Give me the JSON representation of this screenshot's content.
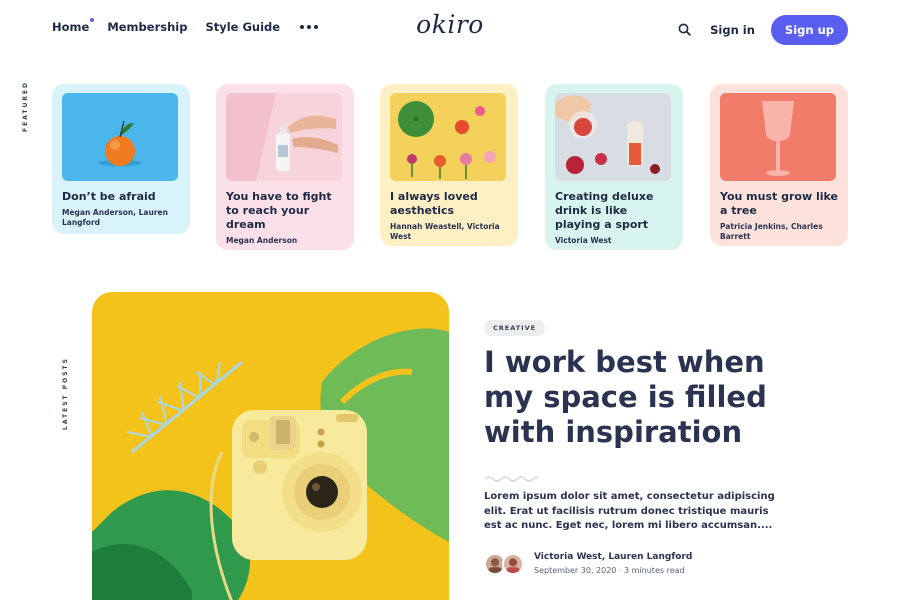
{
  "header": {
    "nav": [
      "Home",
      "Membership",
      "Style Guide"
    ],
    "logo": "okiro",
    "signin": "Sign in",
    "signup": "Sign up",
    "accent": "#5a5ef0"
  },
  "sections": {
    "featured": "FEATURED",
    "latest": "LATEST POSTS"
  },
  "featured": [
    {
      "title": "Don’t be afraid",
      "authors": "Megan Anderson, Lauren Langford",
      "bg": "#d9f3fb"
    },
    {
      "title": "You have to fight to reach your dream",
      "authors": "Megan Anderson",
      "bg": "#fbe0ea"
    },
    {
      "title": "I always loved aesthetics",
      "authors": "Hannah Weastell, Victoria West",
      "bg": "#fdf0c4"
    },
    {
      "title": "Creating deluxe drink is like playing a sport",
      "authors": "Victoria West",
      "bg": "#d8f4ee"
    },
    {
      "title": "You must grow like a tree",
      "authors": "Patricia Jenkins, Charles Barrett",
      "bg": "#fde2dc"
    }
  ],
  "post": {
    "tag": "CREATIVE",
    "headline": "I work best when my space is filled with inspiration",
    "excerpt": "Lorem ipsum dolor sit amet, consectetur adipiscing elit. Erat ut facilisis rutrum donec tristique mauris est ac nunc. Eget nec, lorem mi libero accumsan....",
    "authors": "Victoria West, Lauren Langford",
    "date": "September 30, 2020",
    "read_time": "3 minutes read",
    "meta": "September 30, 2020 · 3 minutes read"
  }
}
